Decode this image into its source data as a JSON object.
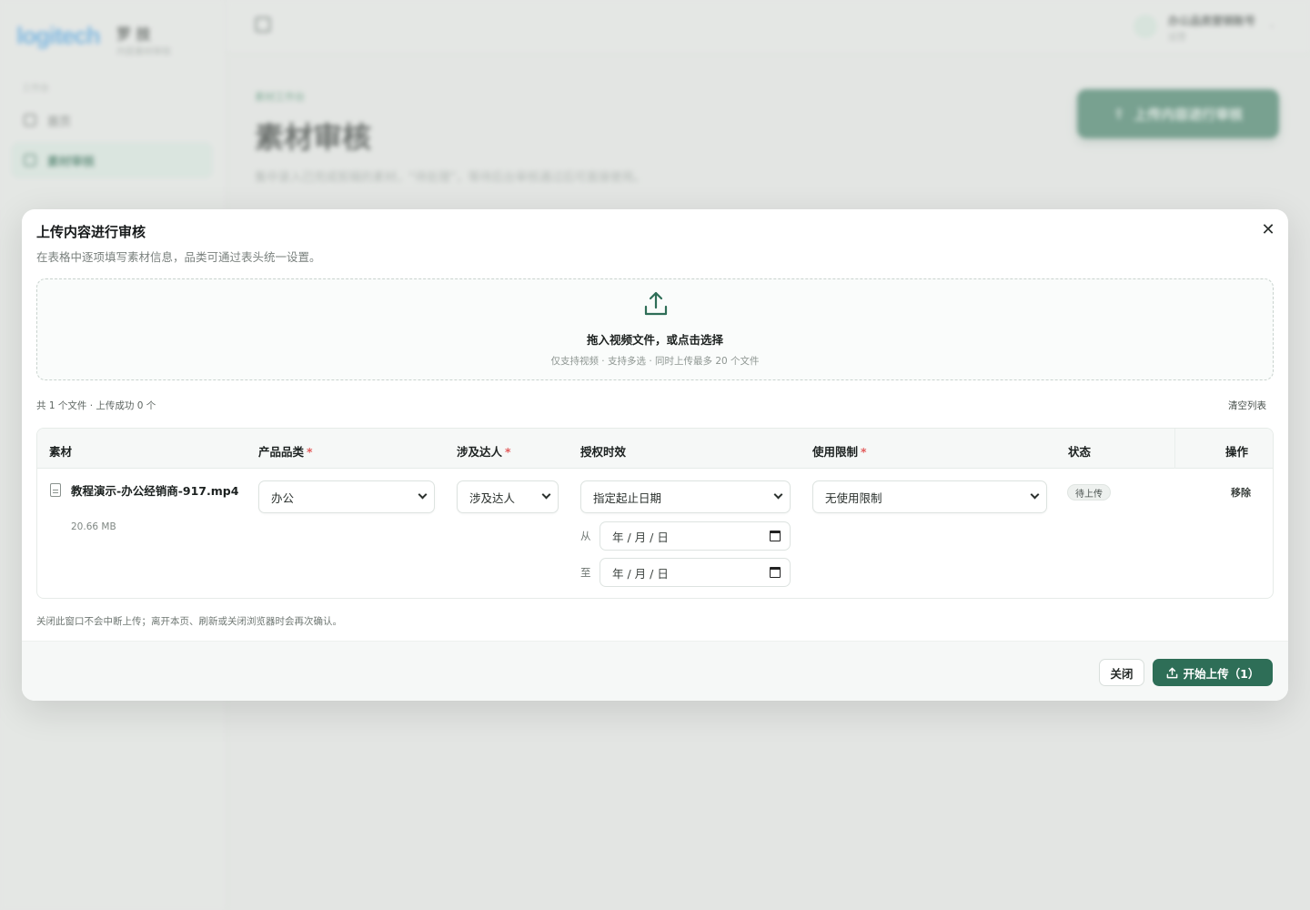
{
  "colors": {
    "primary": "#2e6e57",
    "required": "#e35d5d",
    "logo": "#4ea1dd"
  },
  "background": {
    "logo": "logitech",
    "brand_title": "罗 技",
    "brand_subtitle": "内容素材审核",
    "section_label": "工作台",
    "nav": [
      {
        "label": "首页",
        "icon": "home-icon"
      },
      {
        "label": "素材审核",
        "icon": "review-icon",
        "active": true
      }
    ],
    "user_name": "办公品类营销账号",
    "user_role": "运营",
    "breadcrumb": "素材工作台",
    "page_title": "素材审核",
    "page_desc": "集中录入已完成剪辑的素材，“待处理”，等待后台审核通过后可直接使用。",
    "upload_button": "上传内容进行审核"
  },
  "modal": {
    "title": "上传内容进行审核",
    "subtitle": "在表格中逐项填写素材信息，品类可通过表头统一设置。",
    "dropzone": {
      "icon": "upload-icon",
      "main_text": "拖入视频文件，或点击选择",
      "hint_text": "仅支持视频 · 支持多选 · 同时上传最多 20 个文件"
    },
    "file_summary": "共 1 个文件 · 上传成功 0 个",
    "clear_list": "清空列表",
    "table": {
      "headers": [
        {
          "label": "素材",
          "required": false
        },
        {
          "label": "产品品类",
          "required": true
        },
        {
          "label": "涉及达人",
          "required": true
        },
        {
          "label": "授权时效",
          "required": false
        },
        {
          "label": "使用限制",
          "required": true
        },
        {
          "label": "状态",
          "required": false
        },
        {
          "label": "操作",
          "required": false
        }
      ],
      "required_mark": "*",
      "rows": [
        {
          "file_name": "教程演示-办公经销商-917.mp4",
          "file_size": "20.66 MB",
          "category": "办公",
          "talent": "涉及达人",
          "authorization": "指定起止日期",
          "date_from_label": "从",
          "date_from_placeholder": "年 / 月 / 日",
          "date_to_label": "至",
          "date_to_placeholder": "年 / 月 / 日",
          "usage_limit": "无使用限制",
          "status": "待上传",
          "action": "移除"
        }
      ]
    },
    "footnote": "关闭此窗口不会中断上传；离开本页、刷新或关闭浏览器时会再次确认。",
    "close_button": "关闭",
    "start_button": "开始上传（1）"
  }
}
